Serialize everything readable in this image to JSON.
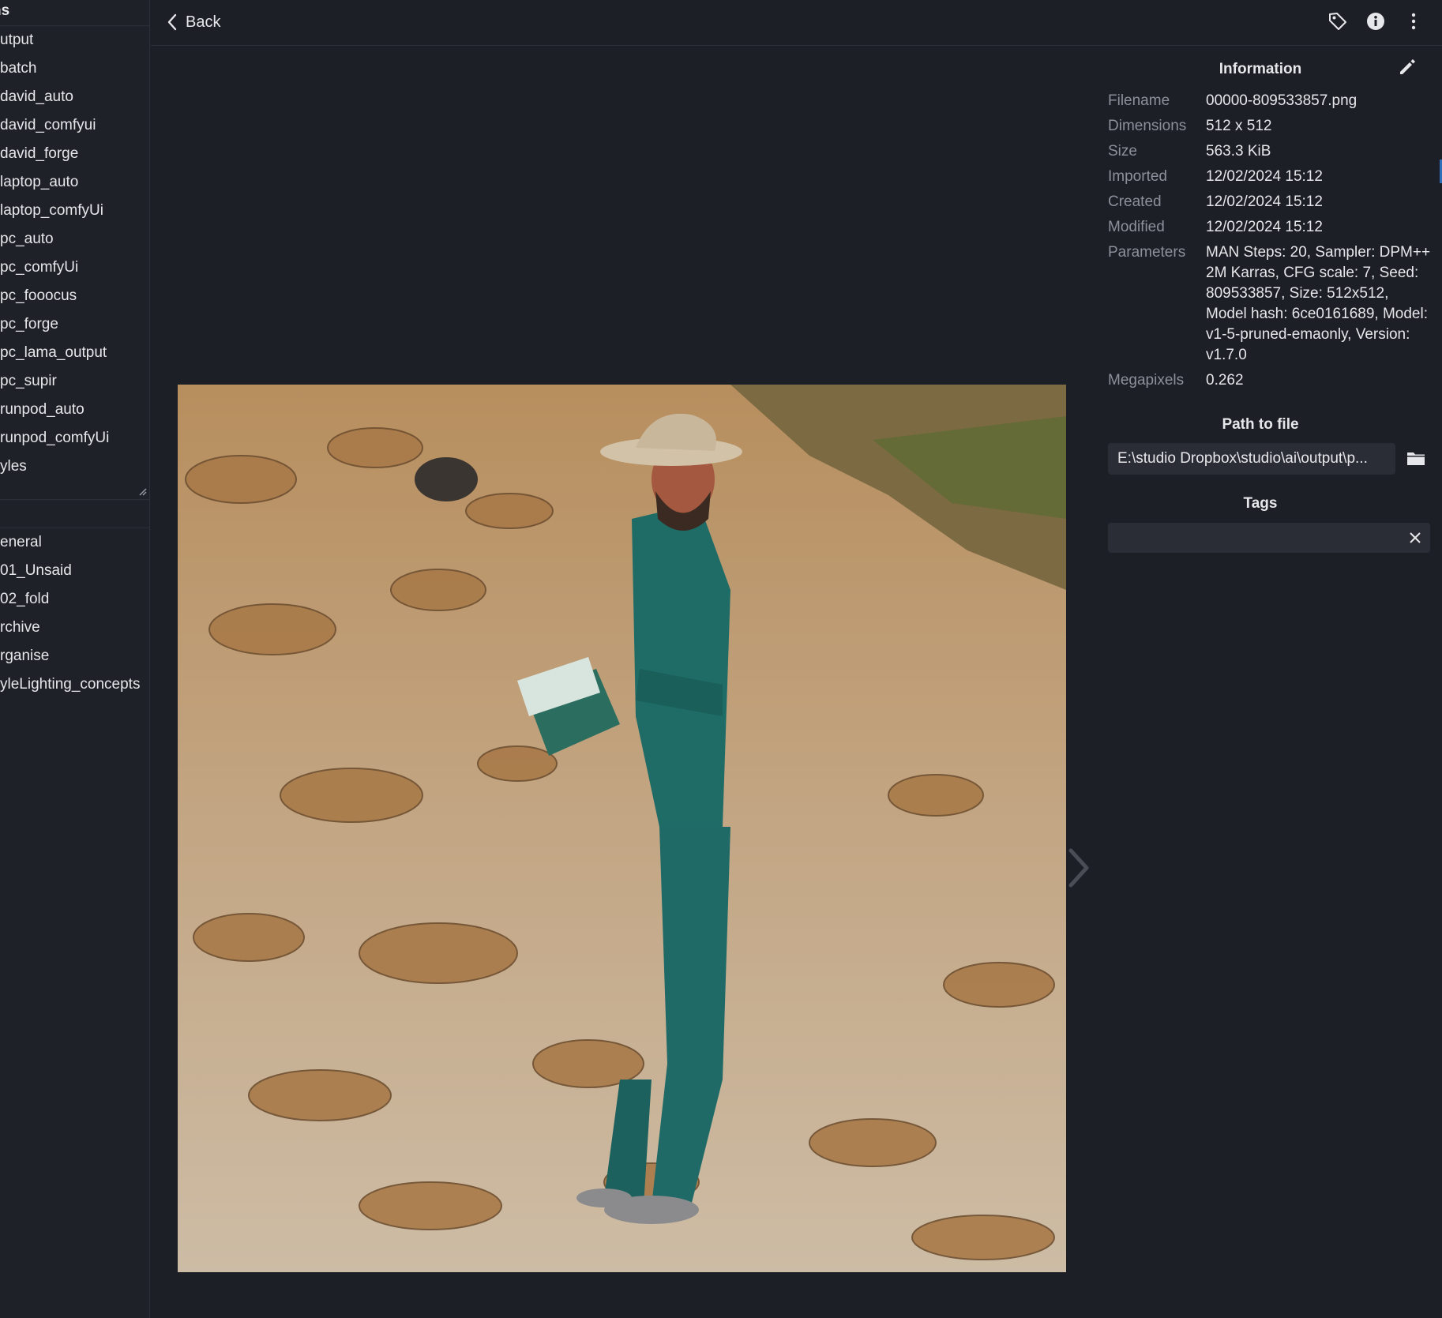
{
  "sidebar": {
    "header": "ns",
    "folders": [
      "utput",
      "batch",
      "david_auto",
      "david_comfyui",
      "david_forge",
      "laptop_auto",
      "laptop_comfyUi",
      "pc_auto",
      "pc_comfyUi",
      "pc_fooocus",
      "pc_forge",
      "pc_lama_output",
      "pc_supir",
      "runpod_auto",
      "runpod_comfyUi",
      "yles"
    ],
    "collections": [
      "eneral",
      "01_Unsaid",
      "02_fold",
      "rchive",
      "rganise",
      "yleLighting_concepts"
    ]
  },
  "topbar": {
    "back_label": "Back"
  },
  "info": {
    "title": "Information",
    "rows": [
      {
        "key": "Filename",
        "value": "00000-809533857.png"
      },
      {
        "key": "Dimensions",
        "value": "512 x 512"
      },
      {
        "key": "Size",
        "value": "563.3 KiB"
      },
      {
        "key": "Imported",
        "value": "12/02/2024 15:12"
      },
      {
        "key": "Created",
        "value": "12/02/2024 15:12"
      },
      {
        "key": "Modified",
        "value": "12/02/2024 15:12"
      },
      {
        "key": "Parameters",
        "value": "MAN Steps: 20, Sampler: DPM++ 2M Karras, CFG scale: 7, Seed: 809533857, Size: 512x512, Model hash: 6ce0161689, Model: v1-5-pruned-emaonly, Version: v1.7.0"
      },
      {
        "key": "Megapixels",
        "value": "0.262"
      }
    ],
    "path_title": "Path to file",
    "path_value": "E:\\studio Dropbox\\studio\\ai\\output\\p...",
    "tags_title": "Tags",
    "tags_value": ""
  },
  "colors": {
    "background": "#1d1f27",
    "sidebar": "#1f2129",
    "field": "#2a2d36",
    "muted_text": "#8d909a",
    "accent": "#2f6fba"
  },
  "icons": [
    "chevron-left-icon",
    "tag-icon",
    "info-icon",
    "more-vertical-icon",
    "pencil-icon",
    "folder-icon",
    "close-icon",
    "chevron-right-icon",
    "resize-grip-icon"
  ]
}
